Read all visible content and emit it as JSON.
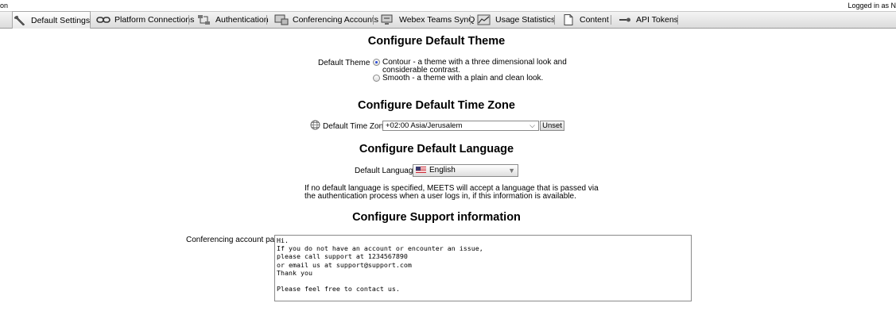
{
  "topbar": {
    "left_text": "on",
    "right_text": "Logged in as N"
  },
  "tabs": [
    {
      "label": "Default Settings",
      "icon": "wrench-icon",
      "active": true
    },
    {
      "label": "Platform Connections",
      "icon": "link-icon"
    },
    {
      "label": "Authentication",
      "icon": "authentication-icon"
    },
    {
      "label": "Conferencing Accounts",
      "icon": "monitor-icon"
    },
    {
      "label": "Webex Teams SynQ",
      "icon": "sync-monitor-icon"
    },
    {
      "label": "Usage Statistics",
      "icon": "chart-icon"
    },
    {
      "label": "Content",
      "icon": "document-icon"
    },
    {
      "label": "API Tokens",
      "icon": "key-icon"
    }
  ],
  "theme": {
    "heading": "Configure Default Theme",
    "label": "Default Theme",
    "options": [
      {
        "text_line1": "Contour - a theme with a three dimensional look and",
        "text_line2": "considerable contrast.",
        "selected": true
      },
      {
        "text_line1": "Smooth - a theme with a plain and clean look.",
        "selected": false
      }
    ]
  },
  "timezone": {
    "heading": "Configure Default Time Zone",
    "label": "Default Time Zone",
    "icon": "globe-icon",
    "value": "+02:00 Asia/Jerusalem",
    "unset_label": "Unset"
  },
  "language": {
    "heading": "Configure Default Language",
    "label": "Default Language",
    "value": "English",
    "flag_icon": "us-flag-icon",
    "note_line1": "If no default language is specified, MEETS will accept a language that is passed via",
    "note_line2": "the authentication process when a user logs in, if this information is available."
  },
  "support": {
    "heading": "Configure Support information",
    "label": "Conferencing account page",
    "text": "Hi.\nIf you do not have an account or encounter an issue,\nplease call support at 1234567890\nor email us at support@support.com\nThank you\n\nPlease feel free to contact us."
  }
}
